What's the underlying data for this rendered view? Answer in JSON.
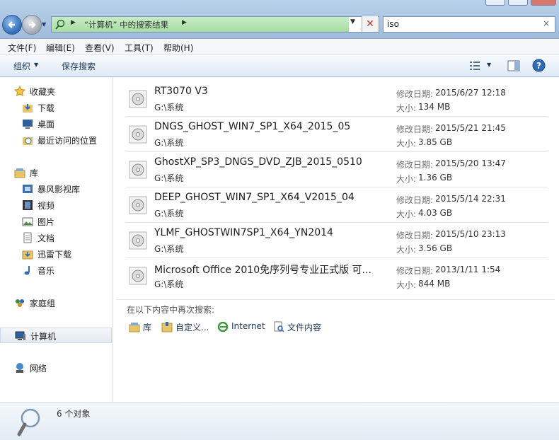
{
  "address": {
    "breadcrumb": "“计算机” 中的搜索结果"
  },
  "search": {
    "value": "iso",
    "clear_glyph": "×"
  },
  "menu": [
    "文件(F)",
    "编辑(E)",
    "查看(V)",
    "工具(T)",
    "帮助(H)"
  ],
  "toolbar": {
    "organize": "组织",
    "save_search": "保存搜索"
  },
  "sidebar": {
    "favorites": {
      "label": "收藏夹",
      "items": [
        "下载",
        "桌面",
        "最近访问的位置"
      ]
    },
    "libraries": {
      "label": "库",
      "items": [
        "暴风影视库",
        "视频",
        "图片",
        "文档",
        "迅雷下载",
        "音乐"
      ]
    },
    "homegroup": "家庭组",
    "computer": "计算机",
    "network": "网络"
  },
  "labels": {
    "modified": "修改日期:",
    "size": "大小:"
  },
  "results": [
    {
      "name": "RT3070 V3",
      "path": "G:\\系统",
      "date": "2015/6/27 12:18",
      "size": "134 MB"
    },
    {
      "name": "DNGS_GHOST_WIN7_SP1_X64_2015_05",
      "path": "G:\\系统",
      "date": "2015/5/21 21:45",
      "size": "3.85 GB"
    },
    {
      "name": "GhostXP_SP3_DNGS_DVD_ZJB_2015_0510",
      "path": "G:\\系统",
      "date": "2015/5/20 13:47",
      "size": "1.36 GB"
    },
    {
      "name": "DEEP_GHOST_WIN7_SP1_X64_V2015_04",
      "path": "G:\\系统",
      "date": "2015/5/14 22:31",
      "size": "4.03 GB"
    },
    {
      "name": "YLMF_GHOSTWIN7SP1_X64_YN2014",
      "path": "G:\\系统",
      "date": "2015/5/10 23:13",
      "size": "3.56 GB"
    },
    {
      "name": "Microsoft Office 2010免序列号专业正式版 可...",
      "path": "G:\\系统",
      "date": "2013/1/11 1:54",
      "size": "844 MB"
    }
  ],
  "search_again": {
    "label": "在以下内容中再次搜索:",
    "options": [
      "库",
      "自定义...",
      "Internet",
      "文件内容"
    ]
  },
  "status": {
    "count": "6 个对象"
  },
  "colors": {
    "accent": "#1e395b",
    "address_progress": "#a7dda3",
    "stop": "#c83232"
  }
}
